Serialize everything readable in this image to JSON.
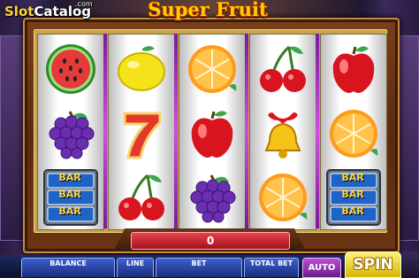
{
  "watermark": {
    "logo": "SlotCatalog",
    "logo_s": "Slot",
    "logo_rest": "Catalog",
    "domain": ".com"
  },
  "game": {
    "title": "Super Fruit"
  },
  "reels": [
    [
      "watermelon",
      "grapes",
      "bar-triple"
    ],
    [
      "lemon",
      "seven",
      "cherries"
    ],
    [
      "orange",
      "apple",
      "grapes"
    ],
    [
      "cherries",
      "bell",
      "orange"
    ],
    [
      "apple",
      "orange",
      "bar-triple"
    ]
  ],
  "bar_symbol": {
    "label": "BAR"
  },
  "win": {
    "value": "0"
  },
  "controls": {
    "balance_label": "BALANCE",
    "line_label": "LINE",
    "bet_label": "BET",
    "total_bet_label": "TOTAL BET",
    "auto_label": "AUTO",
    "spin_label": "SPIN"
  },
  "colors": {
    "title": "#ffcc00",
    "spin": "#f2d21c",
    "auto": "#9a3cc0",
    "panel": "#2b44a8",
    "win_bar": "#c8202e"
  }
}
